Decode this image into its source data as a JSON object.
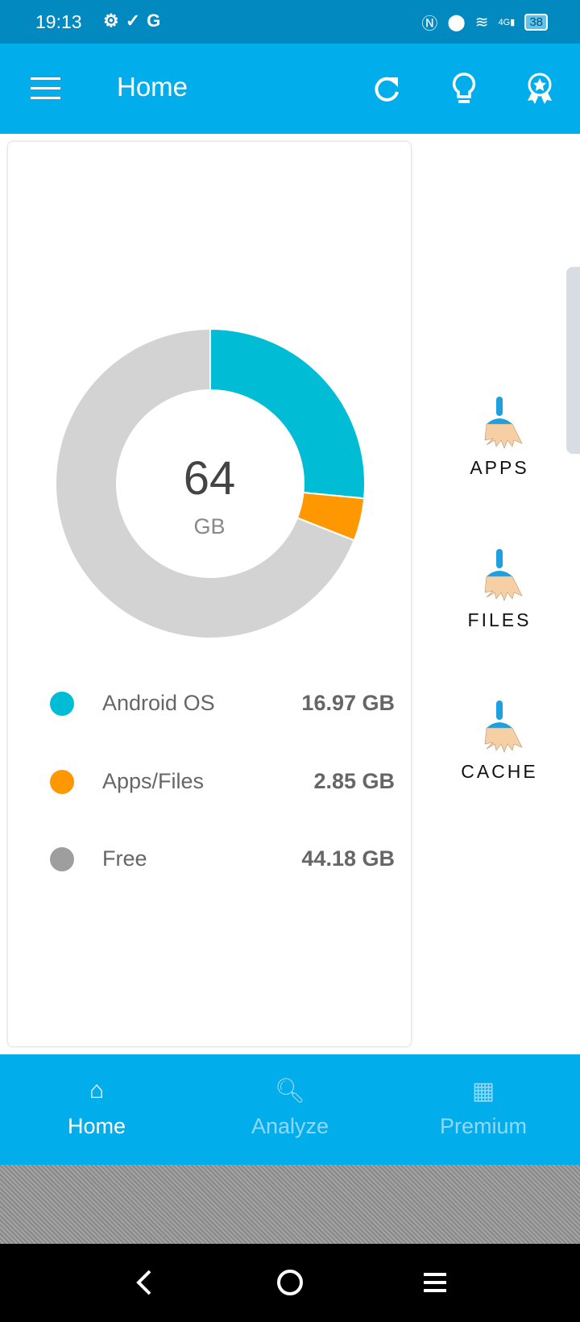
{
  "status_bar": {
    "time": "19:13",
    "network": "4G",
    "battery": "38"
  },
  "app_bar": {
    "title": "Home",
    "icons": [
      "menu-icon",
      "refresh-icon",
      "lightbulb-icon",
      "award-icon"
    ]
  },
  "storage": {
    "total": "64",
    "unit": "GB",
    "items": [
      {
        "label": "Android OS",
        "value": "16.97 GB",
        "amount": 16.97,
        "color": "#00bcd4"
      },
      {
        "label": "Apps/Files",
        "value": "2.85 GB",
        "amount": 2.85,
        "color": "#ff9800"
      },
      {
        "label": "Free",
        "value": "44.18 GB",
        "amount": 44.18,
        "color": "#9e9e9e",
        "ring_color": "#d3d3d3"
      }
    ]
  },
  "cleaners": [
    {
      "label": "APPS"
    },
    {
      "label": "FILES"
    },
    {
      "label": "CACHE"
    }
  ],
  "bottom_nav": [
    {
      "label": "Home",
      "active": true
    },
    {
      "label": "Analyze",
      "active": false
    },
    {
      "label": "Premium",
      "active": false
    }
  ]
}
